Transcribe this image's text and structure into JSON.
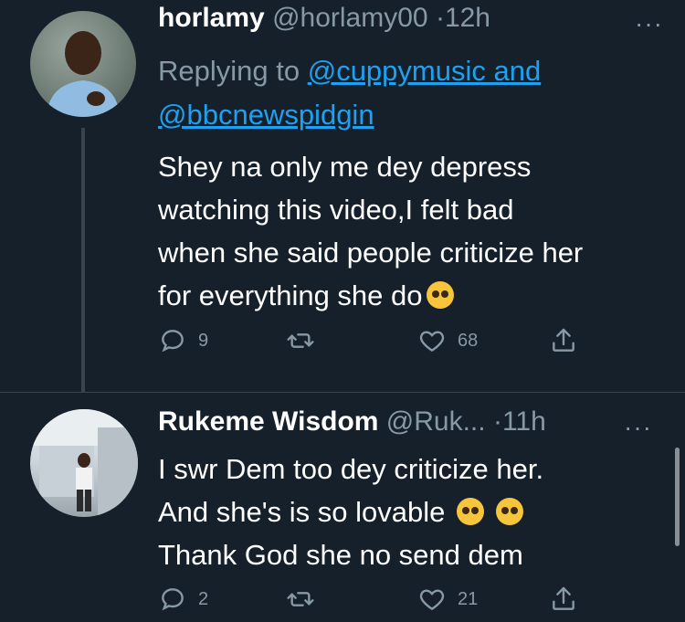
{
  "tweets": [
    {
      "name": "horlamy",
      "handle": "@horlamy00",
      "dot": "·",
      "time": "12h",
      "more": "···",
      "replying_prefix": "Replying to ",
      "replying_mention_1": "@cuppymusic and",
      "replying_mention_2": "@bbcnewspidgin",
      "text_lines": [
        "Shey na only me dey depress",
        "watching this video,I felt bad",
        "when she said people criticize her",
        "for everything she do"
      ],
      "emoji": "pleading-face-emoji",
      "actions": {
        "reply_count": "9",
        "retweet_count": "",
        "like_count": "68"
      }
    },
    {
      "name": "Rukeme Wisdom",
      "handle": "@Ruk...",
      "dot": "·",
      "time": "11h",
      "more": "···",
      "text_lines": [
        "I swr Dem too dey criticize her.",
        "And she's is so lovable",
        "Thank God she no send dem"
      ],
      "emoji": "weary-face-emoji",
      "actions": {
        "reply_count": "2",
        "retweet_count": "",
        "like_count": "21"
      }
    }
  ],
  "colors": {
    "background": "#15202b",
    "secondary_text": "#8899a6",
    "link": "#1da1f2",
    "divider": "#38444d",
    "emoji": "#f7c53c"
  },
  "icons": [
    "reply-icon",
    "retweet-icon",
    "like-icon",
    "share-icon",
    "more-icon"
  ]
}
